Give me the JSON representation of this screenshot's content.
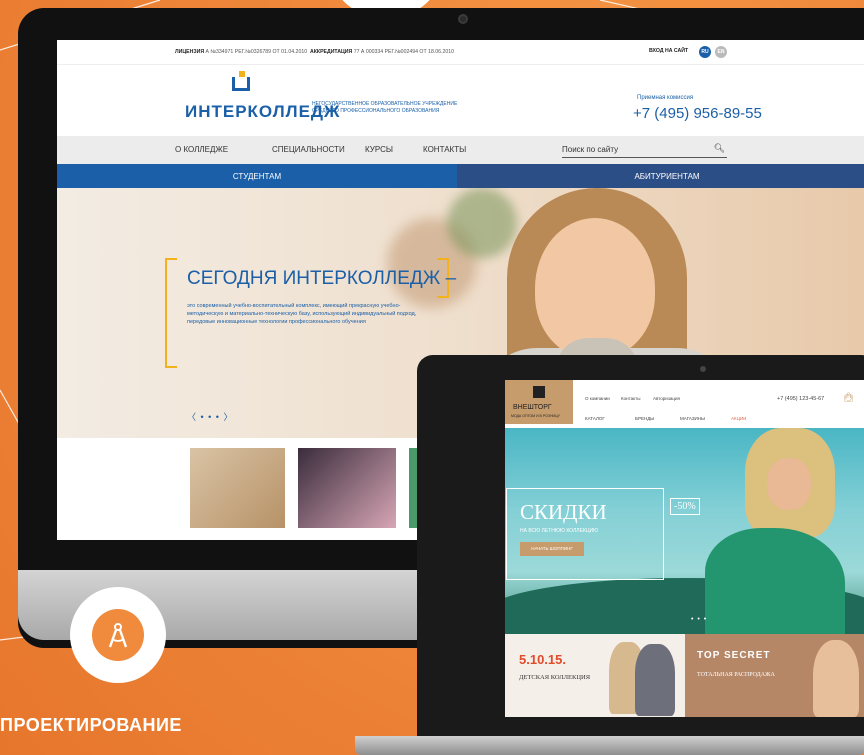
{
  "interkolledzh": {
    "topbar": {
      "license": "ЛИЦЕНЗИЯ",
      "license_text": "А №334971 РЕГ.№0326789 ОТ 01.04.2010",
      "accreditation": "АККРЕДИТАЦИЯ",
      "accreditation_text": "77 А 000334 РЕГ.№002494 ОТ 18.06.2010",
      "login": "ВХОД НА САЙТ",
      "lang_ru": "RU",
      "lang_en": "EN"
    },
    "header": {
      "logo": "ИНТЕРКОЛЛЕДЖ",
      "subtitle": "НЕГОСУДАРСТВЕННОЕ ОБРАЗОВАТЕЛЬНОЕ УЧРЕЖДЕНИЕ СРЕДНЕГО ПРОФЕССИОНАЛЬНОГО ОБРАЗОВАНИЯ",
      "admissions_label": "Приемная комиссия",
      "admissions_phone": "+7 (495) 956-89-55"
    },
    "menu": [
      "О КОЛЛЕДЖЕ",
      "СПЕЦИАЛЬНОСТИ",
      "КУРСЫ",
      "КОНТАКТЫ"
    ],
    "search_placeholder": "Поиск по сайту",
    "tabs": [
      "СТУДЕНТАМ",
      "АБИТУРИЕНТАМ"
    ],
    "hero": {
      "title": "СЕГОДНЯ ИНТЕРКОЛЛЕДЖ –",
      "text": "это современный учебно-воспитательный комплекс, имеющий прекрасную учебно-методическую и материально-техническую базу, использующий индивидуальный подход, передовые инновационные технологии профессионального обучения",
      "slider_dots": "〈 • • • 〉"
    }
  },
  "vneshtorg": {
    "logo": "ВНЕШТОРГ",
    "logo_sub": "МОДА ОПТОМ И В РОЗНИЦУ",
    "nav_top": [
      "О компании",
      "Контакты",
      "Авторизация"
    ],
    "phone": "+7 (495) 123-45-67",
    "menu": [
      "КАТАЛОГ",
      "БРЕНДЫ",
      "МАГАЗИНЫ",
      "АКЦИИ"
    ],
    "hero": {
      "title": "СКИДКИ",
      "subtitle": "НА ВСЮ ЛЕТНЮЮ КОЛЛЕКЦИЮ",
      "button": "НАЧАТЬ ШОППИНГ",
      "discount": "-50%",
      "dots": "• • •"
    },
    "banners": [
      {
        "title": "5.10.15.",
        "subtitle": "ДЕТСКАЯ КОЛЛЕКЦИЯ"
      },
      {
        "title": "TOP SECRET",
        "subtitle": "ТОТАЛЬНАЯ РАСПРОДАЖА"
      }
    ]
  },
  "caption": "ПРОЕКТИРОВАНИЕ",
  "icons": {
    "badge": "compass-icon",
    "search": "search-icon",
    "bag": "shopping-bag-icon"
  },
  "colors": {
    "background": "#f08a3c",
    "brand_blue": "#1a5fa8",
    "accent_gold": "#c79c6c"
  }
}
